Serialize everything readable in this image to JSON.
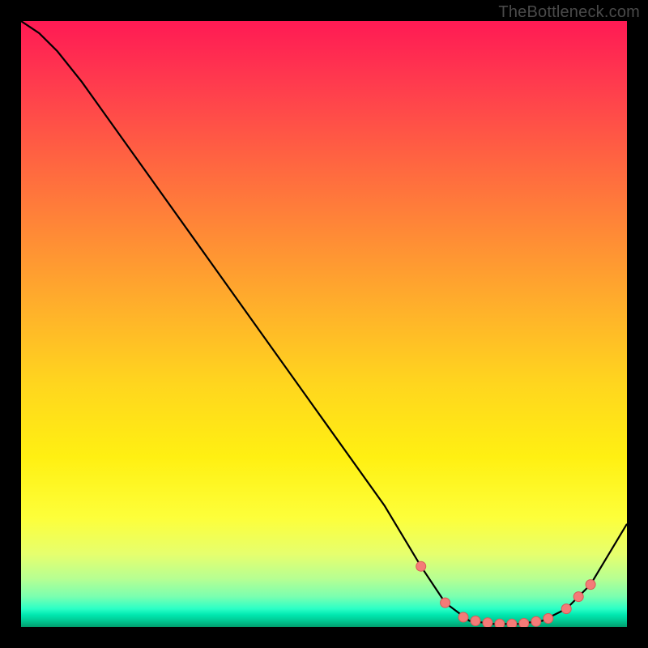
{
  "attribution": "TheBottleneck.com",
  "colors": {
    "curve_stroke": "#000000",
    "marker_fill": "#f47b78",
    "marker_stroke": "#d95a57"
  },
  "chart_data": {
    "type": "line",
    "title": "",
    "xlabel": "",
    "ylabel": "",
    "xlim": [
      0,
      100
    ],
    "ylim": [
      0,
      100
    ],
    "series": [
      {
        "name": "curve",
        "x": [
          0,
          3,
          6,
          10,
          20,
          30,
          40,
          50,
          60,
          66,
          70,
          74,
          78,
          82,
          86,
          90,
          94,
          100
        ],
        "y": [
          100,
          98,
          95,
          90,
          76,
          62,
          48,
          34,
          20,
          10,
          4,
          1,
          0.5,
          0.5,
          1,
          3,
          7,
          17
        ]
      }
    ],
    "markers": {
      "name": "highlight-points",
      "x": [
        66,
        70,
        73,
        75,
        77,
        79,
        81,
        83,
        85,
        87,
        90,
        92,
        94
      ],
      "y": [
        10,
        4,
        1.6,
        1,
        0.7,
        0.5,
        0.5,
        0.6,
        0.9,
        1.4,
        3,
        5,
        7
      ]
    }
  }
}
